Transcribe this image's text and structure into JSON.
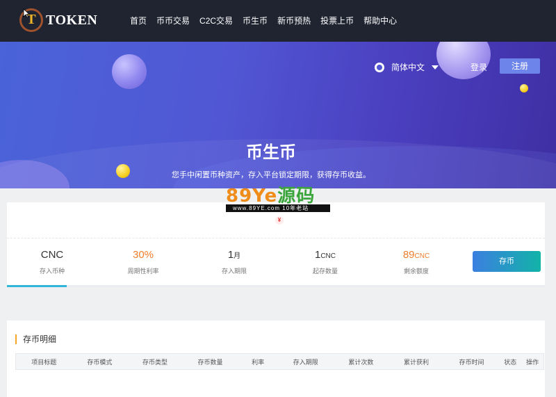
{
  "header": {
    "logo_letter": "T",
    "logo_text": "TOKEN",
    "nav": [
      "首页",
      "币币交易",
      "C2C交易",
      "币生币",
      "新币预热",
      "投票上币",
      "帮助中心"
    ]
  },
  "hero": {
    "language": "简体中文",
    "login": "登录",
    "register": "注册",
    "title": "币生币",
    "subtitle": "您手中闲置币种资产，存入平台锁定期限，获得存币收益。"
  },
  "watermark": {
    "main_prefix": "89Ye",
    "main_suffix": "源码",
    "bar": "www.89YE.com    10年老站"
  },
  "product": {
    "currency_symbol": "¥",
    "stats": [
      {
        "value": "CNC",
        "unit": "",
        "label": "存入币种"
      },
      {
        "value": "30%",
        "unit": "",
        "label": "周期性利率"
      },
      {
        "value": "1",
        "unit": "月",
        "label": "存入期限"
      },
      {
        "value": "1",
        "unit": "CNC",
        "label": "起存数量"
      },
      {
        "value": "89",
        "unit": "CNC",
        "label": "剩余额度"
      }
    ],
    "deposit_button": "存币"
  },
  "details": {
    "title": "存币明细",
    "columns": [
      "项目标题",
      "存币模式",
      "存币类型",
      "存币数量",
      "利率",
      "存入期限",
      "累计次数",
      "累计获利",
      "存币时间",
      "状态",
      "操作"
    ]
  },
  "colors": {
    "nav_bg": "#1f2430",
    "accent_orange": "#f07d2c",
    "title_bar": "#f5a623",
    "active_tab": "#2fb6d8"
  }
}
